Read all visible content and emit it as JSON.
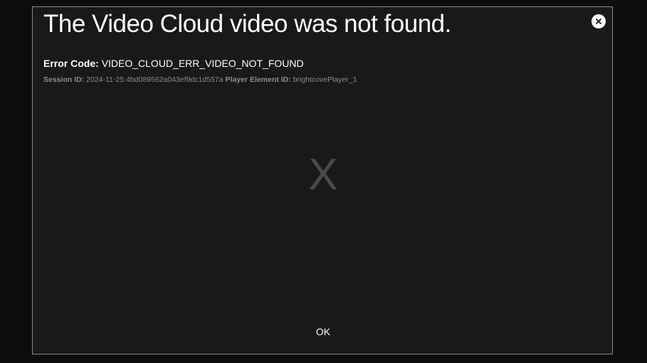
{
  "dialog": {
    "title": "The Video Cloud video was not found.",
    "close_icon": "close-icon",
    "error_code_label": "Error Code:",
    "error_code_value": "VIDEO_CLOUD_ERR_VIDEO_NOT_FOUND",
    "session_label": "Session ID:",
    "session_value": "2024-11-25:4bd089562a043ef9dc1d557a",
    "player_element_label": "Player Element ID:",
    "player_element_value": "brightcovePlayer_1",
    "error_symbol": "X",
    "ok_label": "OK"
  },
  "colors": {
    "page_background": "#0d0d0d",
    "dialog_background": "#191919",
    "dialog_border": "#8a8a8a",
    "text_primary": "#ffffff",
    "text_secondary": "#8c8c8c",
    "error_symbol": "#4a4a4a"
  }
}
